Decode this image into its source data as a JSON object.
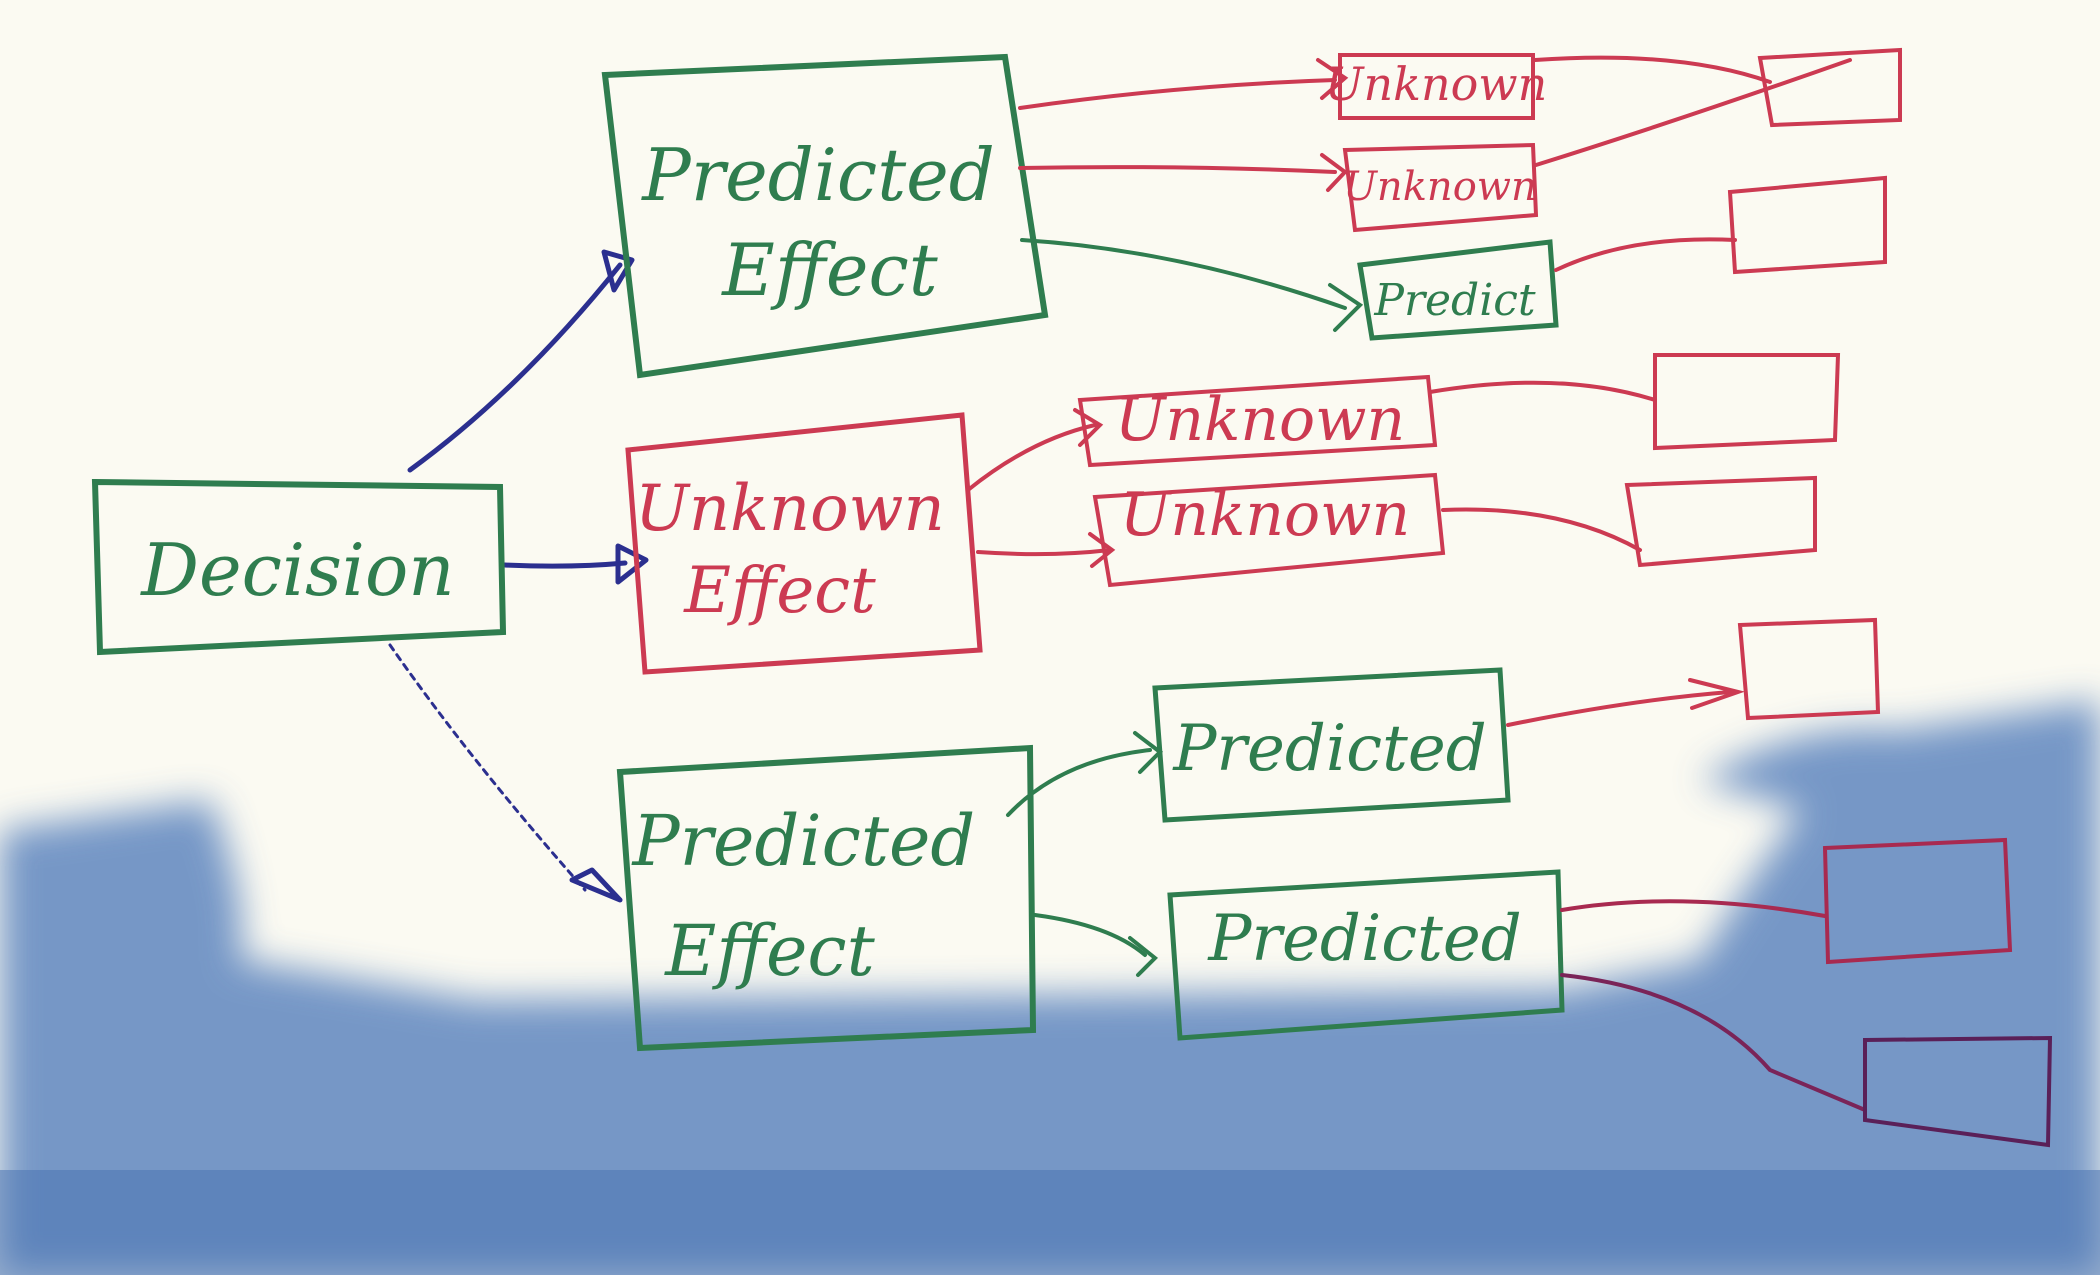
{
  "colors": {
    "paper": "#fbfaf2",
    "green": "#2f7d4f",
    "red": "#cc3a52",
    "blue": "#2b2f8f",
    "purple": "#5a2058",
    "shadow": "#5f86bf"
  },
  "nodes": {
    "decision": "Decision",
    "effect_top": "Predicted\nEffect",
    "effect_mid": "Unknown\nEffect",
    "effect_bot": "Predicted\nEffect",
    "t1": "Unknown",
    "t2": "Unknown",
    "t3": "Predict",
    "m1": "Unknown",
    "m2": "Unknown",
    "b1": "Predicted",
    "b2": "Predicted"
  }
}
